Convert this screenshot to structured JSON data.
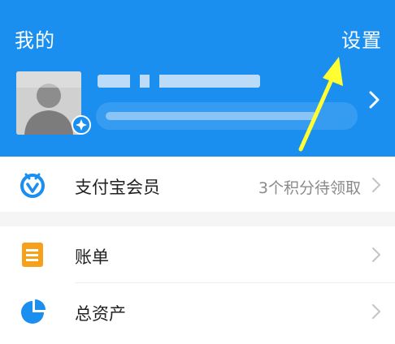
{
  "header": {
    "title": "我的",
    "settings_label": "设置",
    "bg_color": "#1a8ff0"
  },
  "profile": {
    "avatar_icon": "user-avatar-icon",
    "badge_icon": "alipay-badge-icon"
  },
  "member_row": {
    "icon": "member-icon",
    "label": "支付宝会员",
    "hint": "3个积分待领取"
  },
  "menu": [
    {
      "icon": "bill-icon",
      "label": "账单"
    },
    {
      "icon": "assets-pie-icon",
      "label": "总资产"
    }
  ],
  "colors": {
    "accent": "#1a8ff0",
    "bill_icon": "#f5a21a",
    "annotation_arrow": "#ffff33"
  }
}
